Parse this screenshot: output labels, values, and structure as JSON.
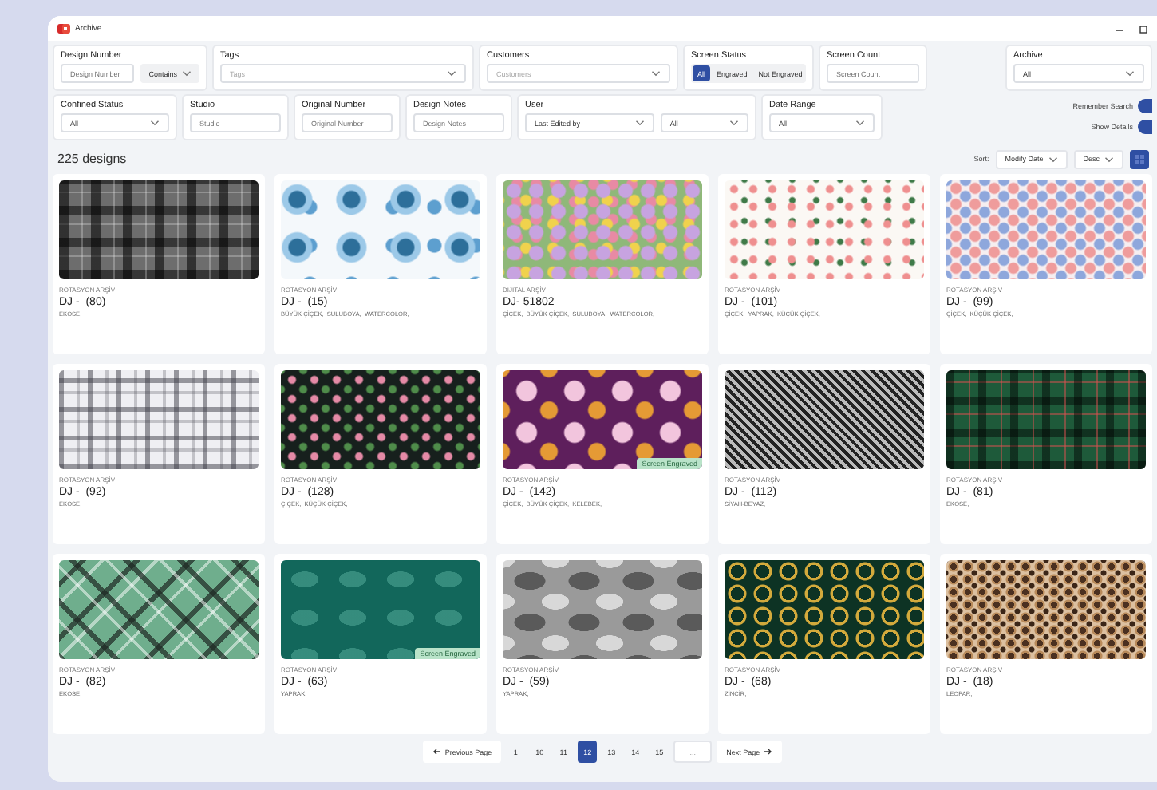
{
  "window": {
    "title": "Archive"
  },
  "filters_row_1": [
    {
      "kind": "text-select",
      "label": "Design Number",
      "placeholder": "Design Number",
      "option": "Contains"
    },
    {
      "kind": "select",
      "label": "Tags",
      "placeholder": "Tags"
    },
    {
      "kind": "select",
      "label": "Customers",
      "placeholder": "Customers"
    },
    {
      "kind": "segmented",
      "label": "Screen Status",
      "options": [
        {
          "label": "All",
          "selected": true
        },
        {
          "label": "Engraved",
          "selected": false
        },
        {
          "label": "Not Engraved",
          "selected": false
        }
      ]
    },
    {
      "kind": "text",
      "label": "Screen Count",
      "placeholder": "Screen Count"
    },
    {
      "kind": "spacer"
    },
    {
      "kind": "select",
      "label": "Archive",
      "value": "All"
    }
  ],
  "filters_row_2": [
    {
      "kind": "select",
      "label": "Confined Status",
      "value": "All"
    },
    {
      "kind": "text",
      "label": "Studio",
      "placeholder": "Studio"
    },
    {
      "kind": "text",
      "label": "Original Number",
      "placeholder": "Original Number"
    },
    {
      "kind": "text",
      "label": "Design Notes",
      "placeholder": "Design Notes"
    },
    {
      "kind": "dual-select",
      "label": "User",
      "value": "Last Edited by",
      "value_2": "All"
    },
    {
      "kind": "select",
      "label": "Date Range",
      "value": "All"
    }
  ],
  "toggles": [
    {
      "label": "Remember Search",
      "on": true
    },
    {
      "label": "Show Details",
      "on": true
    }
  ],
  "count": "225 designs",
  "sort": {
    "label": "Sort:",
    "field": "Modify Date",
    "order": "Desc"
  },
  "designs": [
    {
      "kind": "plaid-gray",
      "source": "ROTASYON ARŞİV",
      "title": "DJ -  (80)",
      "tags": "EKOSE,"
    },
    {
      "kind": "floral-blue",
      "source": "ROTASYON ARŞİV",
      "title": "DJ -  (15)",
      "tags": "BÜYÜK ÇİÇEK,  SULUBOYA,  WATERCOLOR,"
    },
    {
      "kind": "floral-multi",
      "source": "DIJITAL ARŞİV",
      "title": "DJ- 51802",
      "tags": "ÇİÇEK,  BÜYÜK ÇİÇEK,  SULUBOYA,  WATERCOLOR,"
    },
    {
      "kind": "floral-white",
      "source": "ROTASYON ARŞİV",
      "title": "DJ -  (101)",
      "tags": "ÇİÇEK,  YAPRAK,  KÜÇÜK ÇİÇEK,"
    },
    {
      "kind": "floral-pastel",
      "source": "ROTASYON ARŞİV",
      "title": "DJ -  (99)",
      "tags": "ÇİÇEK,  KÜÇÜK ÇİÇEK,"
    },
    {
      "kind": "plaid-white",
      "source": "ROTASYON ARŞİV",
      "title": "DJ -  (92)",
      "tags": "EKOSE,"
    },
    {
      "kind": "floral-dark",
      "source": "ROTASYON ARŞİV",
      "title": "DJ -  (128)",
      "tags": "ÇİÇEK,  KÜÇÜK ÇİÇEK,"
    },
    {
      "kind": "floral-purple",
      "source": "ROTASYON ARŞİV",
      "title": "DJ -  (142)",
      "tags": "ÇİÇEK,  BÜYÜK ÇİÇEK,  KELEBEK,",
      "badge": "Screen Engraved"
    },
    {
      "kind": "geometric-bw",
      "source": "ROTASYON ARŞİV",
      "title": "DJ -  (112)",
      "tags": "SİYAH-BEYAZ,"
    },
    {
      "kind": "plaid-green",
      "source": "ROTASYON ARŞİV",
      "title": "DJ -  (81)",
      "tags": "EKOSE,"
    },
    {
      "kind": "plaid-mint",
      "source": "ROTASYON ARŞİV",
      "title": "DJ -  (82)",
      "tags": "EKOSE,"
    },
    {
      "kind": "leaf-teal",
      "source": "ROTASYON ARŞİV",
      "title": "DJ -  (63)",
      "tags": "YAPRAK,",
      "badge": "Screen Engraved"
    },
    {
      "kind": "leaf-gray",
      "source": "ROTASYON ARŞİV",
      "title": "DJ -  (59)",
      "tags": "YAPRAK,"
    },
    {
      "kind": "chain-green",
      "source": "ROTASYON ARŞİV",
      "title": "DJ -  (68)",
      "tags": "ZİNCİR,"
    },
    {
      "kind": "leopard",
      "source": "ROTASYON ARŞİV",
      "title": "DJ -  (18)",
      "tags": "LEOPAR,"
    }
  ],
  "pagination": {
    "previous": "Previous Page",
    "next": "Next Page",
    "ellipsis": "...",
    "pages": [
      {
        "label": "1",
        "selected": false
      },
      {
        "label": "10",
        "selected": false
      },
      {
        "label": "11",
        "selected": false
      },
      {
        "label": "12",
        "selected": true
      },
      {
        "label": "13",
        "selected": false
      },
      {
        "label": "14",
        "selected": false
      },
      {
        "label": "15",
        "selected": false
      }
    ]
  }
}
